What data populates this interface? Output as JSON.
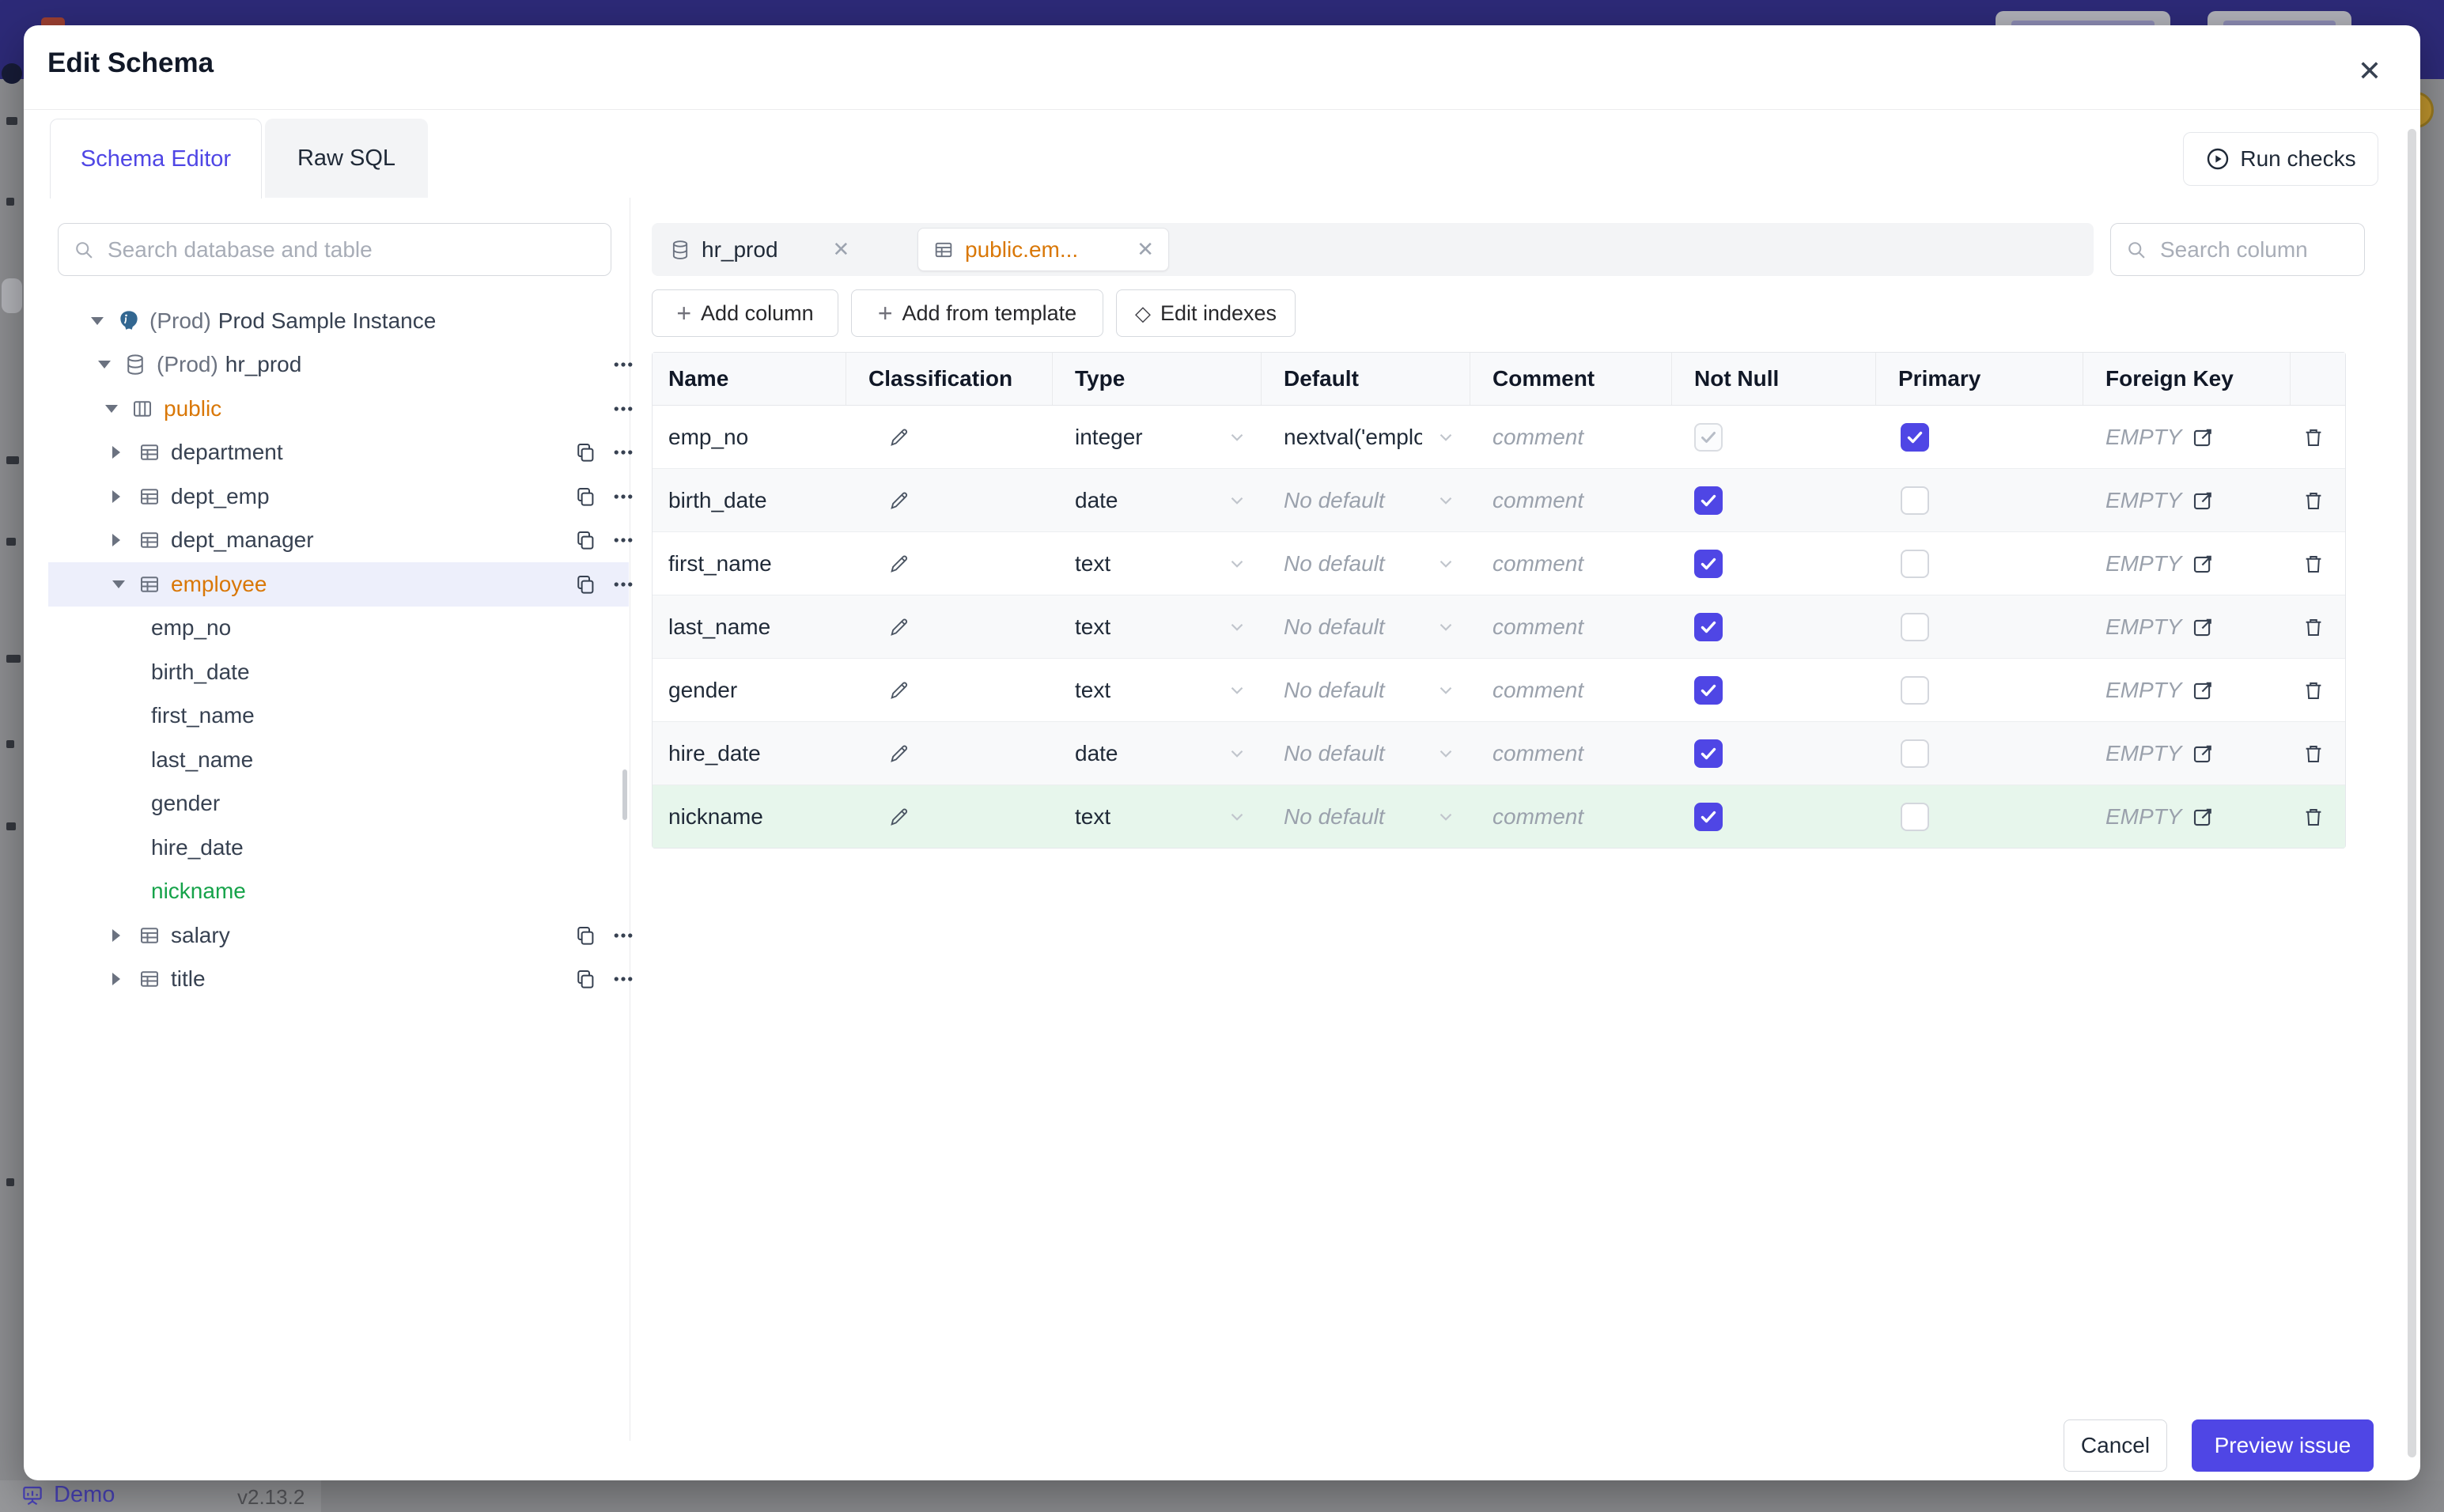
{
  "colors": {
    "accent": "#4f46e5",
    "modified": "#d97706",
    "new_item": "#16a34a",
    "new_row_bg": "#e7f6ec",
    "banner": "#2d2a78"
  },
  "backdrop": {
    "demo_label": "Demo",
    "version": "v2.13.2"
  },
  "modal": {
    "title": "Edit Schema",
    "close_icon": "✕",
    "tabs": [
      {
        "label": "Schema Editor",
        "active": true
      },
      {
        "label": "Raw SQL",
        "active": false
      }
    ],
    "run_checks_label": "Run checks",
    "sidebar": {
      "search_placeholder": "Search database and table",
      "tree": [
        {
          "kind": "instance",
          "level": 0,
          "expanded": true,
          "icon": "postgres-icon",
          "prefix": "(Prod)",
          "label": "Prod Sample Instance"
        },
        {
          "kind": "database",
          "level": 1,
          "expanded": true,
          "icon": "database-icon",
          "prefix": "(Prod)",
          "label": "hr_prod",
          "menu": true
        },
        {
          "kind": "schema",
          "level": 2,
          "expanded": true,
          "icon": "schema-icon",
          "label": "public",
          "state": "modified",
          "menu": true
        },
        {
          "kind": "table",
          "level": 3,
          "expanded": false,
          "icon": "table-icon",
          "label": "department",
          "copy": true,
          "menu": true
        },
        {
          "kind": "table",
          "level": 3,
          "expanded": false,
          "icon": "table-icon",
          "label": "dept_emp",
          "copy": true,
          "menu": true
        },
        {
          "kind": "table",
          "level": 3,
          "expanded": false,
          "icon": "table-icon",
          "label": "dept_manager",
          "copy": true,
          "menu": true
        },
        {
          "kind": "table",
          "level": 3,
          "expanded": true,
          "icon": "table-icon",
          "label": "employee",
          "state": "modified",
          "highlighted": true,
          "copy": true,
          "menu": true
        },
        {
          "kind": "column",
          "label": "emp_no"
        },
        {
          "kind": "column",
          "label": "birth_date"
        },
        {
          "kind": "column",
          "label": "first_name"
        },
        {
          "kind": "column",
          "label": "last_name"
        },
        {
          "kind": "column",
          "label": "gender"
        },
        {
          "kind": "column",
          "label": "hire_date"
        },
        {
          "kind": "column",
          "label": "nickname",
          "state": "new"
        },
        {
          "kind": "table",
          "level": 3,
          "expanded": false,
          "icon": "table-icon",
          "label": "salary",
          "copy": true,
          "menu": true
        },
        {
          "kind": "table",
          "level": 3,
          "expanded": false,
          "icon": "table-icon",
          "label": "title",
          "copy": true,
          "menu": true
        }
      ]
    },
    "editor": {
      "chips": [
        {
          "label": "hr_prod",
          "icon": "database-icon",
          "close": "✕"
        },
        {
          "label": "public.em...",
          "icon": "table-icon",
          "close": "✕",
          "active": true,
          "state": "modified"
        }
      ],
      "search_placeholder": "Search column",
      "actions": [
        "Add column",
        "Add from template",
        "Edit indexes"
      ],
      "table": {
        "headers": [
          "Name",
          "Classification",
          "Type",
          "Default",
          "Comment",
          "Not Null",
          "Primary",
          "Foreign Key",
          ""
        ],
        "comment_placeholder": "comment",
        "foreign_key_empty": "EMPTY",
        "rows": [
          {
            "name": "emp_no",
            "type": "integer",
            "default": "nextval('employ",
            "default_is_value": true,
            "not_null": true,
            "not_null_disabled": true,
            "primary": true
          },
          {
            "name": "birth_date",
            "type": "date",
            "default": "No default",
            "not_null": true,
            "primary": false
          },
          {
            "name": "first_name",
            "type": "text",
            "default": "No default",
            "not_null": true,
            "primary": false
          },
          {
            "name": "last_name",
            "type": "text",
            "default": "No default",
            "not_null": true,
            "primary": false
          },
          {
            "name": "gender",
            "type": "text",
            "default": "No default",
            "not_null": true,
            "primary": false
          },
          {
            "name": "hire_date",
            "type": "date",
            "default": "No default",
            "not_null": true,
            "primary": false
          },
          {
            "name": "nickname",
            "type": "text",
            "default": "No default",
            "not_null": true,
            "primary": false,
            "state": "new"
          }
        ]
      }
    },
    "footer": {
      "cancel_label": "Cancel",
      "submit_label": "Preview issue"
    }
  }
}
